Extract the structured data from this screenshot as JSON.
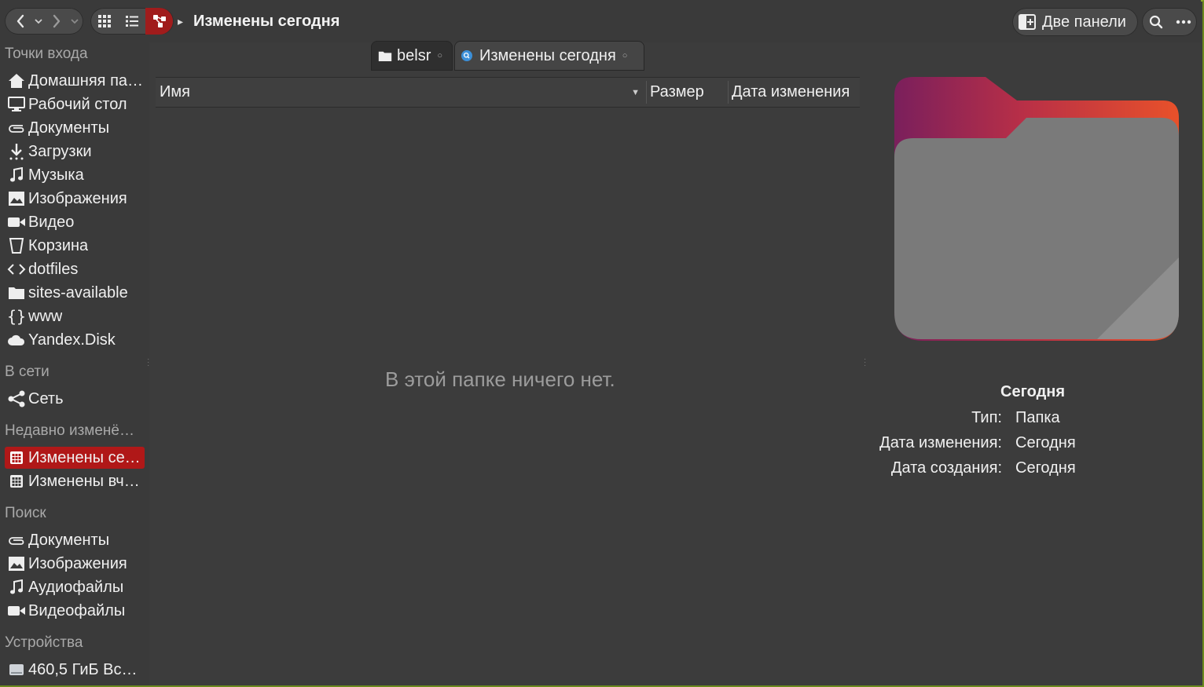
{
  "header": {
    "title": "Изменены сегодня",
    "dual_panel_label": "Две панели"
  },
  "sidebar": {
    "sections": [
      {
        "title": "Точки входа"
      },
      {
        "title": "В сети"
      },
      {
        "title": "Недавно изменё…"
      },
      {
        "title": "Поиск"
      },
      {
        "title": "Устройства"
      }
    ],
    "places": [
      {
        "label": "Домашняя па…",
        "icon": "home-icon"
      },
      {
        "label": "Рабочий стол",
        "icon": "desktop-icon"
      },
      {
        "label": "Документы",
        "icon": "paperclip-icon"
      },
      {
        "label": "Загрузки",
        "icon": "download-icon"
      },
      {
        "label": "Музыка",
        "icon": "music-icon"
      },
      {
        "label": "Изображения",
        "icon": "image-icon"
      },
      {
        "label": "Видео",
        "icon": "video-icon"
      },
      {
        "label": "Корзина",
        "icon": "trash-icon"
      },
      {
        "label": "dotfiles",
        "icon": "code-icon"
      },
      {
        "label": "sites-available",
        "icon": "folder-icon"
      },
      {
        "label": "www",
        "icon": "braces-icon"
      },
      {
        "label": "Yandex.Disk",
        "icon": "cloud-icon"
      }
    ],
    "network": [
      {
        "label": "Сеть",
        "icon": "share-icon"
      }
    ],
    "recent": [
      {
        "label": "Изменены се…",
        "icon": "calendar-icon",
        "selected": true
      },
      {
        "label": "Изменены вч…",
        "icon": "calendar-icon"
      }
    ],
    "search": [
      {
        "label": "Документы",
        "icon": "paperclip-icon"
      },
      {
        "label": "Изображения",
        "icon": "image-icon"
      },
      {
        "label": "Аудиофайлы",
        "icon": "music-icon"
      },
      {
        "label": "Видеофайлы",
        "icon": "video-icon"
      }
    ],
    "devices": [
      {
        "label": "460,5 ГиБ Вс…",
        "icon": "drive-icon"
      }
    ]
  },
  "tabs": [
    {
      "label": "belsr",
      "icon": "folder-icon"
    },
    {
      "label": "Изменены сегодня",
      "icon": "search-badge-icon",
      "active": true
    }
  ],
  "columns": {
    "name": "Имя",
    "size": "Размер",
    "modified": "Дата изменения"
  },
  "main": {
    "empty_message": "В этой папке ничего нет."
  },
  "info": {
    "title": "Сегодня",
    "rows": [
      {
        "key": "Тип:",
        "value": "Папка"
      },
      {
        "key": "Дата изменения:",
        "value": "Сегодня"
      },
      {
        "key": "Дата создания:",
        "value": "Сегодня"
      }
    ]
  },
  "colors": {
    "accent": "#b01818",
    "background": "#3c3c3c",
    "folder_gradient_start": "#7a1f5c",
    "folder_gradient_end": "#e8512a"
  }
}
